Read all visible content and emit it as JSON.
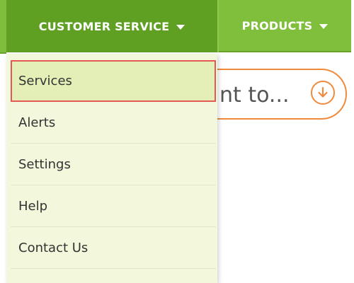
{
  "nav": {
    "customer_service": "CUSTOMER SERVICE",
    "products": "PRODUCTS"
  },
  "search": {
    "placeholder_text": "nt to..."
  },
  "dropdown": {
    "items": [
      {
        "label": "Services",
        "highlighted": true
      },
      {
        "label": "Alerts"
      },
      {
        "label": "Settings"
      },
      {
        "label": "Help"
      },
      {
        "label": "Contact Us"
      }
    ]
  },
  "colors": {
    "nav_active": "#5f9f22",
    "nav_inactive": "#80bf3c",
    "dropdown_bg": "#f3f8dc",
    "highlight_bg": "#e3efb6",
    "highlight_border": "#e25a52",
    "search_accent": "#f08a3c"
  },
  "icons": {
    "dropdown_caret": "chevron-down-icon",
    "search_go": "arrow-down-circle-icon"
  }
}
